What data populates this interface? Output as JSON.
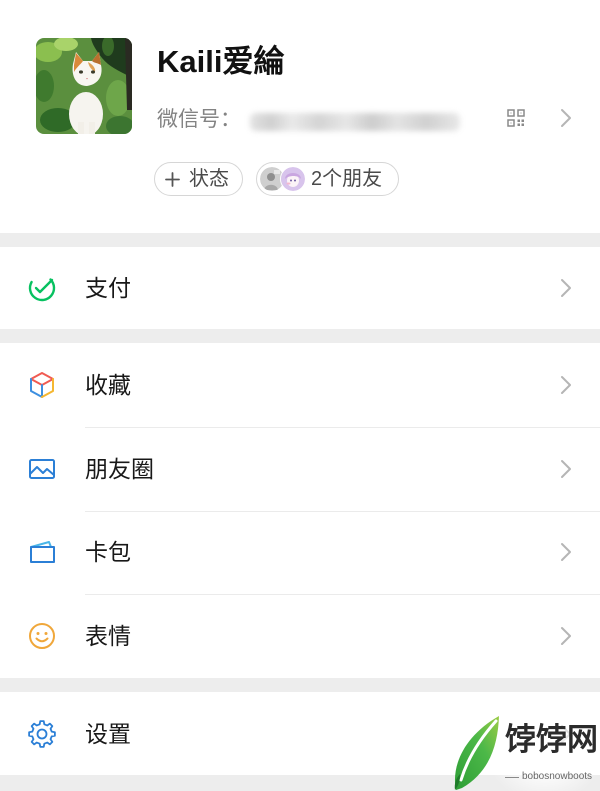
{
  "profile": {
    "name": "Kaili爱綸",
    "wechat_id_label": "微信号：",
    "qr_icon": "qr-code-icon",
    "chevron_icon": "chevron-right-icon",
    "status_button": {
      "icon": "plus-icon",
      "label": "状态"
    },
    "friends_button": {
      "label": "2个朋友"
    }
  },
  "menu": {
    "groups": [
      {
        "items": [
          {
            "label": "支付",
            "icon": "wechat-pay-icon"
          }
        ]
      },
      {
        "items": [
          {
            "label": "收藏",
            "icon": "favorites-cube-icon"
          },
          {
            "label": "朋友圈",
            "icon": "moments-picture-icon"
          },
          {
            "label": "卡包",
            "icon": "card-wallet-icon"
          },
          {
            "label": "表情",
            "icon": "sticker-smiley-icon"
          }
        ]
      },
      {
        "items": [
          {
            "label": "设置",
            "icon": "settings-gear-icon"
          }
        ]
      }
    ]
  },
  "watermark": {
    "title": "饽饽网",
    "subtitle": "bobosnowboots"
  },
  "colors": {
    "background": "#ededed",
    "surface": "#ffffff",
    "pay_green": "#07c160",
    "icon_blue": "#2b7fd6",
    "sticker_orange": "#f0a73a",
    "favorites_red": "#f05b52",
    "favorites_yellow": "#f5b731",
    "secondary_text": "#838383",
    "chevron_gray": "#b5b5b5"
  }
}
